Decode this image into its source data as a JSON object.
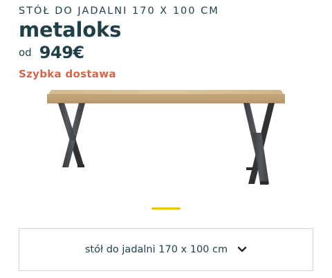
{
  "product": {
    "category": "STÓŁ DO JADALNI 170 X 100 CM",
    "name": "metaloks",
    "price_prefix": "od",
    "price": "949€",
    "delivery": "Szybka dostawa"
  },
  "colors": {
    "text": "#1f4049",
    "delivery": "#d66548",
    "indicator": "#f2c200",
    "border": "#d3d6d8"
  },
  "image": {
    "icon": "dining-table-image"
  },
  "carousel": {
    "active_index": 1,
    "total": 1
  },
  "variant": {
    "selected": "stół do jadalni 170 x 100 cm",
    "icon": "chevron-down-icon"
  }
}
